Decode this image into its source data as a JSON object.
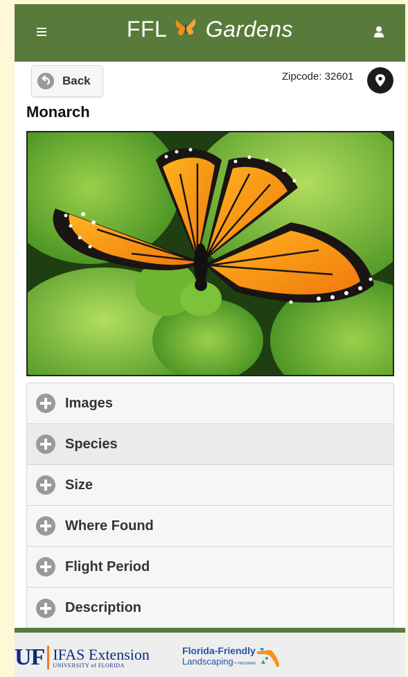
{
  "header": {
    "brand_left": "FFL",
    "brand_right": "Gardens",
    "menu_icon": "hamburger-menu-icon",
    "user_icon": "user-icon",
    "color": "#587b3b"
  },
  "toolbar": {
    "back_label": "Back",
    "zipcode_text": "Zipcode: 32601",
    "location_icon": "map-pin-icon"
  },
  "page": {
    "title": "Monarch",
    "image_subject": "monarch-butterfly-photo"
  },
  "accordion": {
    "items": [
      {
        "label": "Images"
      },
      {
        "label": "Species"
      },
      {
        "label": "Size"
      },
      {
        "label": "Where Found"
      },
      {
        "label": "Flight Period"
      },
      {
        "label": "Description"
      }
    ]
  },
  "footer": {
    "uf_mark": "UF",
    "uf_title": "IFAS Extension",
    "uf_sub": "UNIVERSITY of FLORIDA",
    "ffl_line1": "Florida-Friendly",
    "ffl_line2": "Landscaping",
    "ffl_tm": "™ PROGRAM"
  }
}
